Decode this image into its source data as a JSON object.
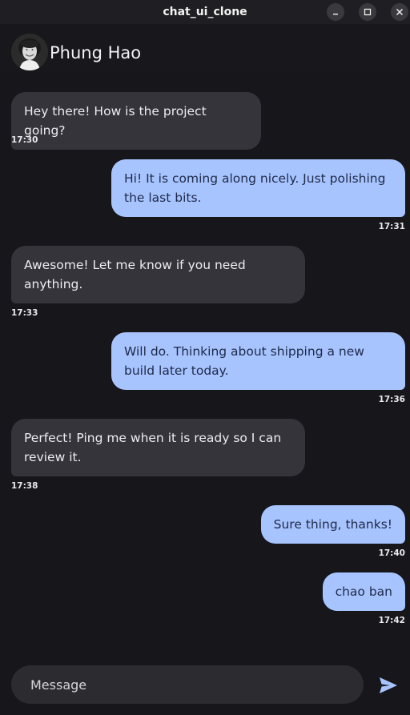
{
  "window": {
    "title": "chat_ui_clone",
    "minimize_glyph": "–",
    "maximize_glyph": "□",
    "close_glyph": "✕"
  },
  "header": {
    "contact_name": "Phung Hao",
    "avatar_icon": "user-avatar-photo"
  },
  "messages": [
    {
      "side": "in",
      "text": "Hey there! How is the project going?",
      "time": "17:30"
    },
    {
      "side": "out",
      "text": "Hi! It is coming along nicely. Just polishing the last bits.",
      "time": "17:31"
    },
    {
      "side": "in",
      "text": "Awesome! Let me know if you need anything.",
      "time": "17:33"
    },
    {
      "side": "out",
      "text": "Will do. Thinking about shipping a new build later today.",
      "time": "17:36"
    },
    {
      "side": "in",
      "text": "Perfect! Ping me when it is ready so I can review it.",
      "time": "17:38"
    },
    {
      "side": "out",
      "text": "Sure thing, thanks!",
      "time": "17:40"
    },
    {
      "side": "out",
      "text": "chao ban",
      "time": "17:42"
    }
  ],
  "composer": {
    "placeholder": "Message",
    "value": "",
    "send_icon": "send-icon"
  },
  "colors": {
    "background": "#16161b",
    "incoming_bubble": "#34343a",
    "outgoing_bubble": "#a8c4ff",
    "accent": "#a8c4ff"
  }
}
